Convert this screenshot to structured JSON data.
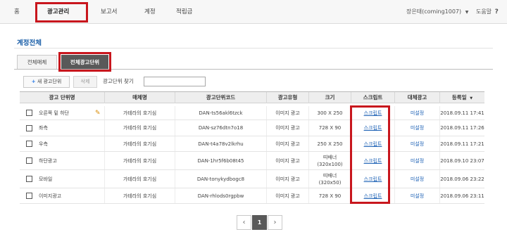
{
  "nav": {
    "items": [
      "홈",
      "광고관리",
      "보고서",
      "계정",
      "적립금"
    ],
    "user": "장은태(coming1007)",
    "help": "도움말"
  },
  "page_title": "계정전체",
  "tabs": [
    "전체매체",
    "전체광고단위"
  ],
  "toolbar": {
    "new_label": "새 광고단위",
    "delete_label": "삭제",
    "search_label": "광고단위 찾기",
    "search_value": ""
  },
  "table": {
    "headers": [
      "광고 단위명",
      "매체명",
      "광고단위코드",
      "광고유형",
      "크기",
      "스크립트",
      "대체광고",
      "등록일"
    ],
    "rows": [
      {
        "name": "오른쪽 밑 하단",
        "media": "가테라의 호기심",
        "code": "DAN-ts56akl6tzck",
        "type": "이미지 광고",
        "size": "300 X 250",
        "script": "스크립트",
        "replace": "미설정",
        "date": "2018.09.11 17:41"
      },
      {
        "name": "좌측",
        "media": "가테라의 호기심",
        "code": "DAN-sz76dtn7o18",
        "type": "이미지 광고",
        "size": "728 X 90",
        "script": "스크립트",
        "replace": "미설정",
        "date": "2018.09.11 17:26"
      },
      {
        "name": "우측",
        "media": "가테라의 호기심",
        "code": "DAN-t4a78v2lkrhu",
        "type": "이미지 광고",
        "size": "250 X 250",
        "script": "스크립트",
        "replace": "미설정",
        "date": "2018.09.11 17:21"
      },
      {
        "name": "하단광고",
        "media": "가테라의 호기심",
        "code": "DAN-1hr5f6b08t45",
        "type": "이미지 광고",
        "size_line1": "띠배너",
        "size_line2": "(320x100)",
        "script": "스크립트",
        "replace": "미설정",
        "date": "2018.09.10 23:07"
      },
      {
        "name": "모바일",
        "media": "가테라의 호기심",
        "code": "DAN-tonykydbogc8",
        "type": "이미지 광고",
        "size_line1": "띠배너",
        "size_line2": "(320x50)",
        "script": "스크립트",
        "replace": "미설정",
        "date": "2018.09.06 23:22"
      },
      {
        "name": "이미지광고",
        "media": "가테라의 호기심",
        "code": "DAN-rhlods0rgpbw",
        "type": "이미지 광고",
        "size": "728 X 90",
        "script": "스크립트",
        "replace": "미설정",
        "date": "2018.09.06 23:11"
      }
    ]
  },
  "pagination": {
    "prev": "‹",
    "current": "1",
    "next": "›"
  },
  "colors": {
    "highlight": "#c8161d",
    "link": "#1a5fb4",
    "active_tab": "#595959"
  }
}
